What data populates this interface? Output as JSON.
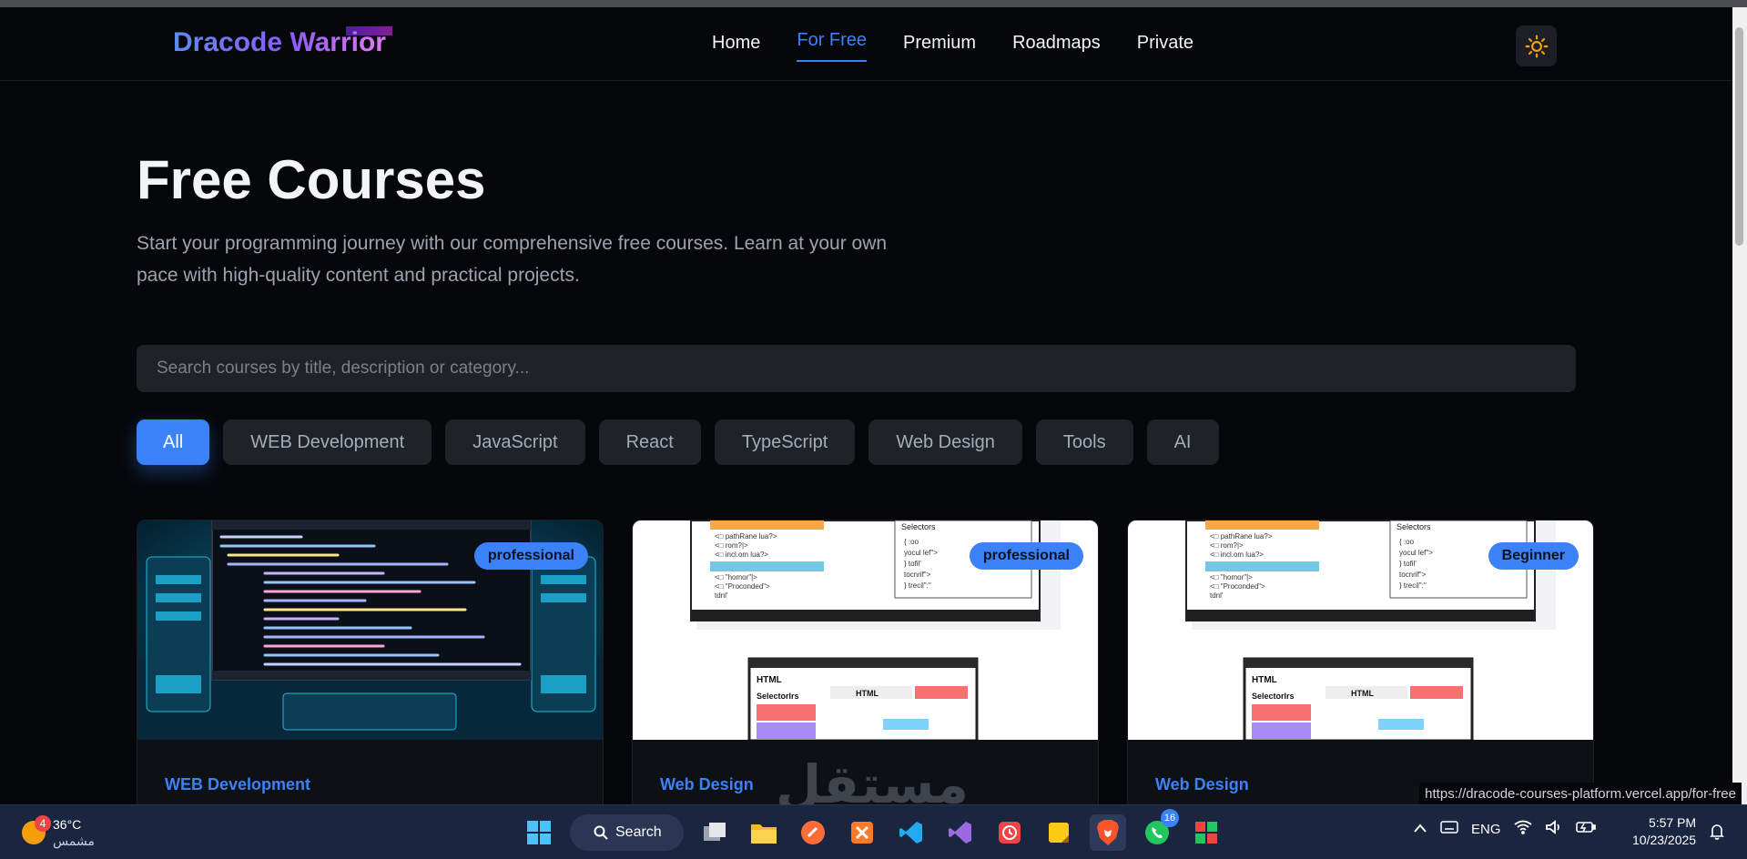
{
  "navbar": {
    "logo": "Dracode Warrior",
    "links": [
      "Home",
      "For Free",
      "Premium",
      "Roadmaps",
      "Private"
    ],
    "active_link": "For Free",
    "theme_icon": "sun-icon"
  },
  "hero": {
    "title": "Free Courses",
    "subtitle": "Start your programming journey with our comprehensive free courses. Learn at your own pace with high-quality content and practical projects."
  },
  "search": {
    "placeholder": "Search courses by title, description or category..."
  },
  "filters": {
    "items": [
      "All",
      "WEB Development",
      "JavaScript",
      "React",
      "TypeScript",
      "Web Design",
      "Tools",
      "AI"
    ],
    "active": "All"
  },
  "courses": [
    {
      "level": "professional",
      "category": "WEB Development"
    },
    {
      "level": "professional",
      "category": "Web Design"
    },
    {
      "level": "Beginner",
      "category": "Web Design"
    }
  ],
  "status_url": "https://dracode-courses-platform.vercel.app/for-free",
  "watermark": "مستقل mostaql.com",
  "taskbar": {
    "weather_temp": "36°C",
    "weather_desc": "مشمس",
    "weather_badge": "4",
    "search_label": "Search",
    "whatsapp_badge": "16",
    "language": "ENG",
    "time": "5:57 PM",
    "date": "10/23/2025"
  },
  "colors": {
    "accent": "#3b82f6",
    "background": "#05070b",
    "surface": "#1f2227"
  }
}
